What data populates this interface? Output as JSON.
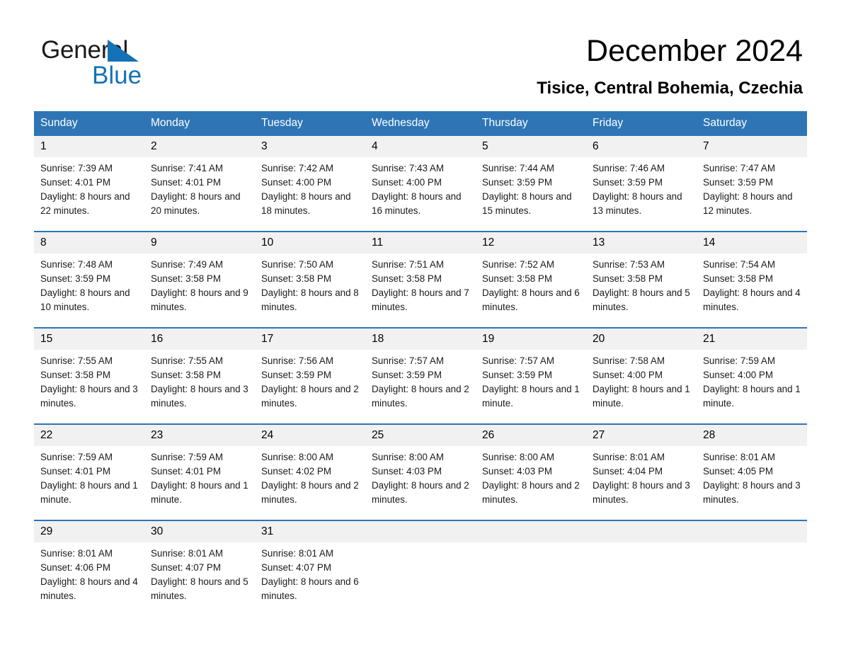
{
  "brand": {
    "line1": "General",
    "line2": "Blue",
    "accent_color": "#1572b6"
  },
  "header": {
    "title": "December 2024",
    "subtitle": "Tisice, Central Bohemia, Czechia"
  },
  "calendar": {
    "header_bg": "#2e75b6",
    "header_text_color": "#ffffff",
    "daynum_bg": "#f1f1f1",
    "weekdays": [
      "Sunday",
      "Monday",
      "Tuesday",
      "Wednesday",
      "Thursday",
      "Friday",
      "Saturday"
    ],
    "weeks": [
      [
        {
          "day": "1",
          "sunrise": "Sunrise: 7:39 AM",
          "sunset": "Sunset: 4:01 PM",
          "daylight": "Daylight: 8 hours and 22 minutes."
        },
        {
          "day": "2",
          "sunrise": "Sunrise: 7:41 AM",
          "sunset": "Sunset: 4:01 PM",
          "daylight": "Daylight: 8 hours and 20 minutes."
        },
        {
          "day": "3",
          "sunrise": "Sunrise: 7:42 AM",
          "sunset": "Sunset: 4:00 PM",
          "daylight": "Daylight: 8 hours and 18 minutes."
        },
        {
          "day": "4",
          "sunrise": "Sunrise: 7:43 AM",
          "sunset": "Sunset: 4:00 PM",
          "daylight": "Daylight: 8 hours and 16 minutes."
        },
        {
          "day": "5",
          "sunrise": "Sunrise: 7:44 AM",
          "sunset": "Sunset: 3:59 PM",
          "daylight": "Daylight: 8 hours and 15 minutes."
        },
        {
          "day": "6",
          "sunrise": "Sunrise: 7:46 AM",
          "sunset": "Sunset: 3:59 PM",
          "daylight": "Daylight: 8 hours and 13 minutes."
        },
        {
          "day": "7",
          "sunrise": "Sunrise: 7:47 AM",
          "sunset": "Sunset: 3:59 PM",
          "daylight": "Daylight: 8 hours and 12 minutes."
        }
      ],
      [
        {
          "day": "8",
          "sunrise": "Sunrise: 7:48 AM",
          "sunset": "Sunset: 3:59 PM",
          "daylight": "Daylight: 8 hours and 10 minutes."
        },
        {
          "day": "9",
          "sunrise": "Sunrise: 7:49 AM",
          "sunset": "Sunset: 3:58 PM",
          "daylight": "Daylight: 8 hours and 9 minutes."
        },
        {
          "day": "10",
          "sunrise": "Sunrise: 7:50 AM",
          "sunset": "Sunset: 3:58 PM",
          "daylight": "Daylight: 8 hours and 8 minutes."
        },
        {
          "day": "11",
          "sunrise": "Sunrise: 7:51 AM",
          "sunset": "Sunset: 3:58 PM",
          "daylight": "Daylight: 8 hours and 7 minutes."
        },
        {
          "day": "12",
          "sunrise": "Sunrise: 7:52 AM",
          "sunset": "Sunset: 3:58 PM",
          "daylight": "Daylight: 8 hours and 6 minutes."
        },
        {
          "day": "13",
          "sunrise": "Sunrise: 7:53 AM",
          "sunset": "Sunset: 3:58 PM",
          "daylight": "Daylight: 8 hours and 5 minutes."
        },
        {
          "day": "14",
          "sunrise": "Sunrise: 7:54 AM",
          "sunset": "Sunset: 3:58 PM",
          "daylight": "Daylight: 8 hours and 4 minutes."
        }
      ],
      [
        {
          "day": "15",
          "sunrise": "Sunrise: 7:55 AM",
          "sunset": "Sunset: 3:58 PM",
          "daylight": "Daylight: 8 hours and 3 minutes."
        },
        {
          "day": "16",
          "sunrise": "Sunrise: 7:55 AM",
          "sunset": "Sunset: 3:58 PM",
          "daylight": "Daylight: 8 hours and 3 minutes."
        },
        {
          "day": "17",
          "sunrise": "Sunrise: 7:56 AM",
          "sunset": "Sunset: 3:59 PM",
          "daylight": "Daylight: 8 hours and 2 minutes."
        },
        {
          "day": "18",
          "sunrise": "Sunrise: 7:57 AM",
          "sunset": "Sunset: 3:59 PM",
          "daylight": "Daylight: 8 hours and 2 minutes."
        },
        {
          "day": "19",
          "sunrise": "Sunrise: 7:57 AM",
          "sunset": "Sunset: 3:59 PM",
          "daylight": "Daylight: 8 hours and 1 minute."
        },
        {
          "day": "20",
          "sunrise": "Sunrise: 7:58 AM",
          "sunset": "Sunset: 4:00 PM",
          "daylight": "Daylight: 8 hours and 1 minute."
        },
        {
          "day": "21",
          "sunrise": "Sunrise: 7:59 AM",
          "sunset": "Sunset: 4:00 PM",
          "daylight": "Daylight: 8 hours and 1 minute."
        }
      ],
      [
        {
          "day": "22",
          "sunrise": "Sunrise: 7:59 AM",
          "sunset": "Sunset: 4:01 PM",
          "daylight": "Daylight: 8 hours and 1 minute."
        },
        {
          "day": "23",
          "sunrise": "Sunrise: 7:59 AM",
          "sunset": "Sunset: 4:01 PM",
          "daylight": "Daylight: 8 hours and 1 minute."
        },
        {
          "day": "24",
          "sunrise": "Sunrise: 8:00 AM",
          "sunset": "Sunset: 4:02 PM",
          "daylight": "Daylight: 8 hours and 2 minutes."
        },
        {
          "day": "25",
          "sunrise": "Sunrise: 8:00 AM",
          "sunset": "Sunset: 4:03 PM",
          "daylight": "Daylight: 8 hours and 2 minutes."
        },
        {
          "day": "26",
          "sunrise": "Sunrise: 8:00 AM",
          "sunset": "Sunset: 4:03 PM",
          "daylight": "Daylight: 8 hours and 2 minutes."
        },
        {
          "day": "27",
          "sunrise": "Sunrise: 8:01 AM",
          "sunset": "Sunset: 4:04 PM",
          "daylight": "Daylight: 8 hours and 3 minutes."
        },
        {
          "day": "28",
          "sunrise": "Sunrise: 8:01 AM",
          "sunset": "Sunset: 4:05 PM",
          "daylight": "Daylight: 8 hours and 3 minutes."
        }
      ],
      [
        {
          "day": "29",
          "sunrise": "Sunrise: 8:01 AM",
          "sunset": "Sunset: 4:06 PM",
          "daylight": "Daylight: 8 hours and 4 minutes."
        },
        {
          "day": "30",
          "sunrise": "Sunrise: 8:01 AM",
          "sunset": "Sunset: 4:07 PM",
          "daylight": "Daylight: 8 hours and 5 minutes."
        },
        {
          "day": "31",
          "sunrise": "Sunrise: 8:01 AM",
          "sunset": "Sunset: 4:07 PM",
          "daylight": "Daylight: 8 hours and 6 minutes."
        },
        {
          "day": "",
          "sunrise": "",
          "sunset": "",
          "daylight": ""
        },
        {
          "day": "",
          "sunrise": "",
          "sunset": "",
          "daylight": ""
        },
        {
          "day": "",
          "sunrise": "",
          "sunset": "",
          "daylight": ""
        },
        {
          "day": "",
          "sunrise": "",
          "sunset": "",
          "daylight": ""
        }
      ]
    ]
  }
}
